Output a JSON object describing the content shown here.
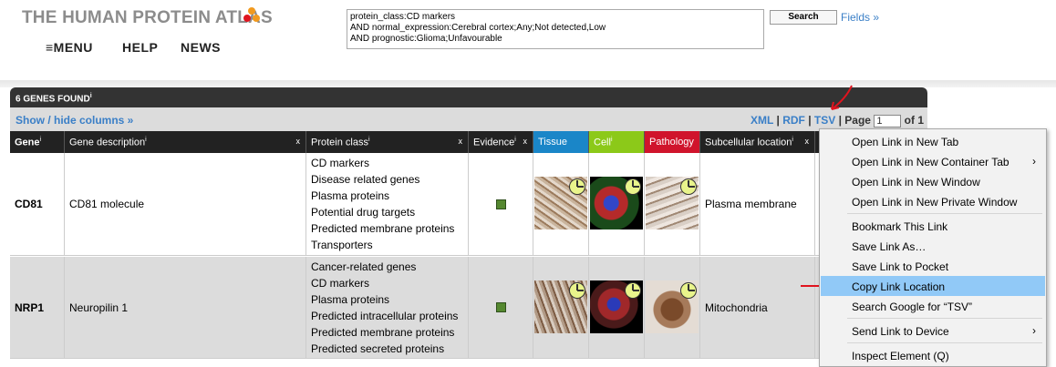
{
  "header": {
    "logo_text": "THE HUMAN PROTEIN ATLAS",
    "nav": [
      "≡MENU",
      "HELP",
      "NEWS"
    ],
    "search_query": "protein_class:CD markers\nAND normal_expression:Cerebral cortex;Any;Not detected,Low\nAND prognostic:Glioma;Unfavourable",
    "search_button": "Search",
    "fields_link": "Fields »"
  },
  "results": {
    "count_label": "6 GENES FOUND",
    "show_hide": "Show / hide columns »",
    "export_links": [
      "XML",
      "RDF",
      "TSV"
    ],
    "page_label": "Page",
    "page_value": "1",
    "page_of": "of 1",
    "columns": [
      {
        "label": "Gene",
        "info": "i",
        "closable": false
      },
      {
        "label": "Gene description",
        "info": "i",
        "closable": true
      },
      {
        "label": "Protein class",
        "info": "i",
        "closable": true
      },
      {
        "label": "Evidence",
        "info": "i",
        "closable": true
      },
      {
        "label": "Tissue",
        "info": "",
        "closable": false
      },
      {
        "label": "Cell",
        "info": "i",
        "closable": false
      },
      {
        "label": "Pathology",
        "info": "",
        "closable": false
      },
      {
        "label": "Subcellular location",
        "info": "i",
        "closable": true
      }
    ],
    "header_colors": {
      "tissue": "#1a86c8",
      "cell": "#8cc919",
      "pathology": "#d0142c"
    },
    "rows": [
      {
        "gene": "CD81",
        "description": "CD81 molecule",
        "protein_classes": [
          "CD markers",
          "Disease related genes",
          "Plasma proteins",
          "Potential drug targets",
          "Predicted membrane proteins",
          "Transporters"
        ],
        "subcellular": "Plasma membrane"
      },
      {
        "gene": "NRP1",
        "description": "Neuropilin 1",
        "protein_classes": [
          "Cancer-related genes",
          "CD markers",
          "Plasma proteins",
          "Predicted intracellular proteins",
          "Predicted membrane proteins",
          "Predicted secreted proteins"
        ],
        "subcellular": "Mitochondria"
      }
    ]
  },
  "context_menu": {
    "items": [
      {
        "label": "Open Link in New Tab",
        "submenu": false
      },
      {
        "label": "Open Link in New Container Tab",
        "submenu": true
      },
      {
        "label": "Open Link in New Window",
        "submenu": false
      },
      {
        "label": "Open Link in New Private Window",
        "submenu": false
      },
      {
        "label": "Bookmark This Link",
        "submenu": false
      },
      {
        "label": "Save Link As…",
        "submenu": false
      },
      {
        "label": "Save Link to Pocket",
        "submenu": false
      },
      {
        "label": "Copy Link Location",
        "submenu": false,
        "highlighted": true
      },
      {
        "label": "Search Google for “TSV”",
        "submenu": false
      },
      {
        "label": "Send Link to Device",
        "submenu": true
      },
      {
        "label": "Inspect Element (Q)",
        "submenu": false
      }
    ]
  },
  "colors": {
    "link": "#3a7fc7",
    "menu_highlight": "#91c9f7",
    "annotation_arrow": "#e0141e",
    "evidence_square": "#558830"
  }
}
